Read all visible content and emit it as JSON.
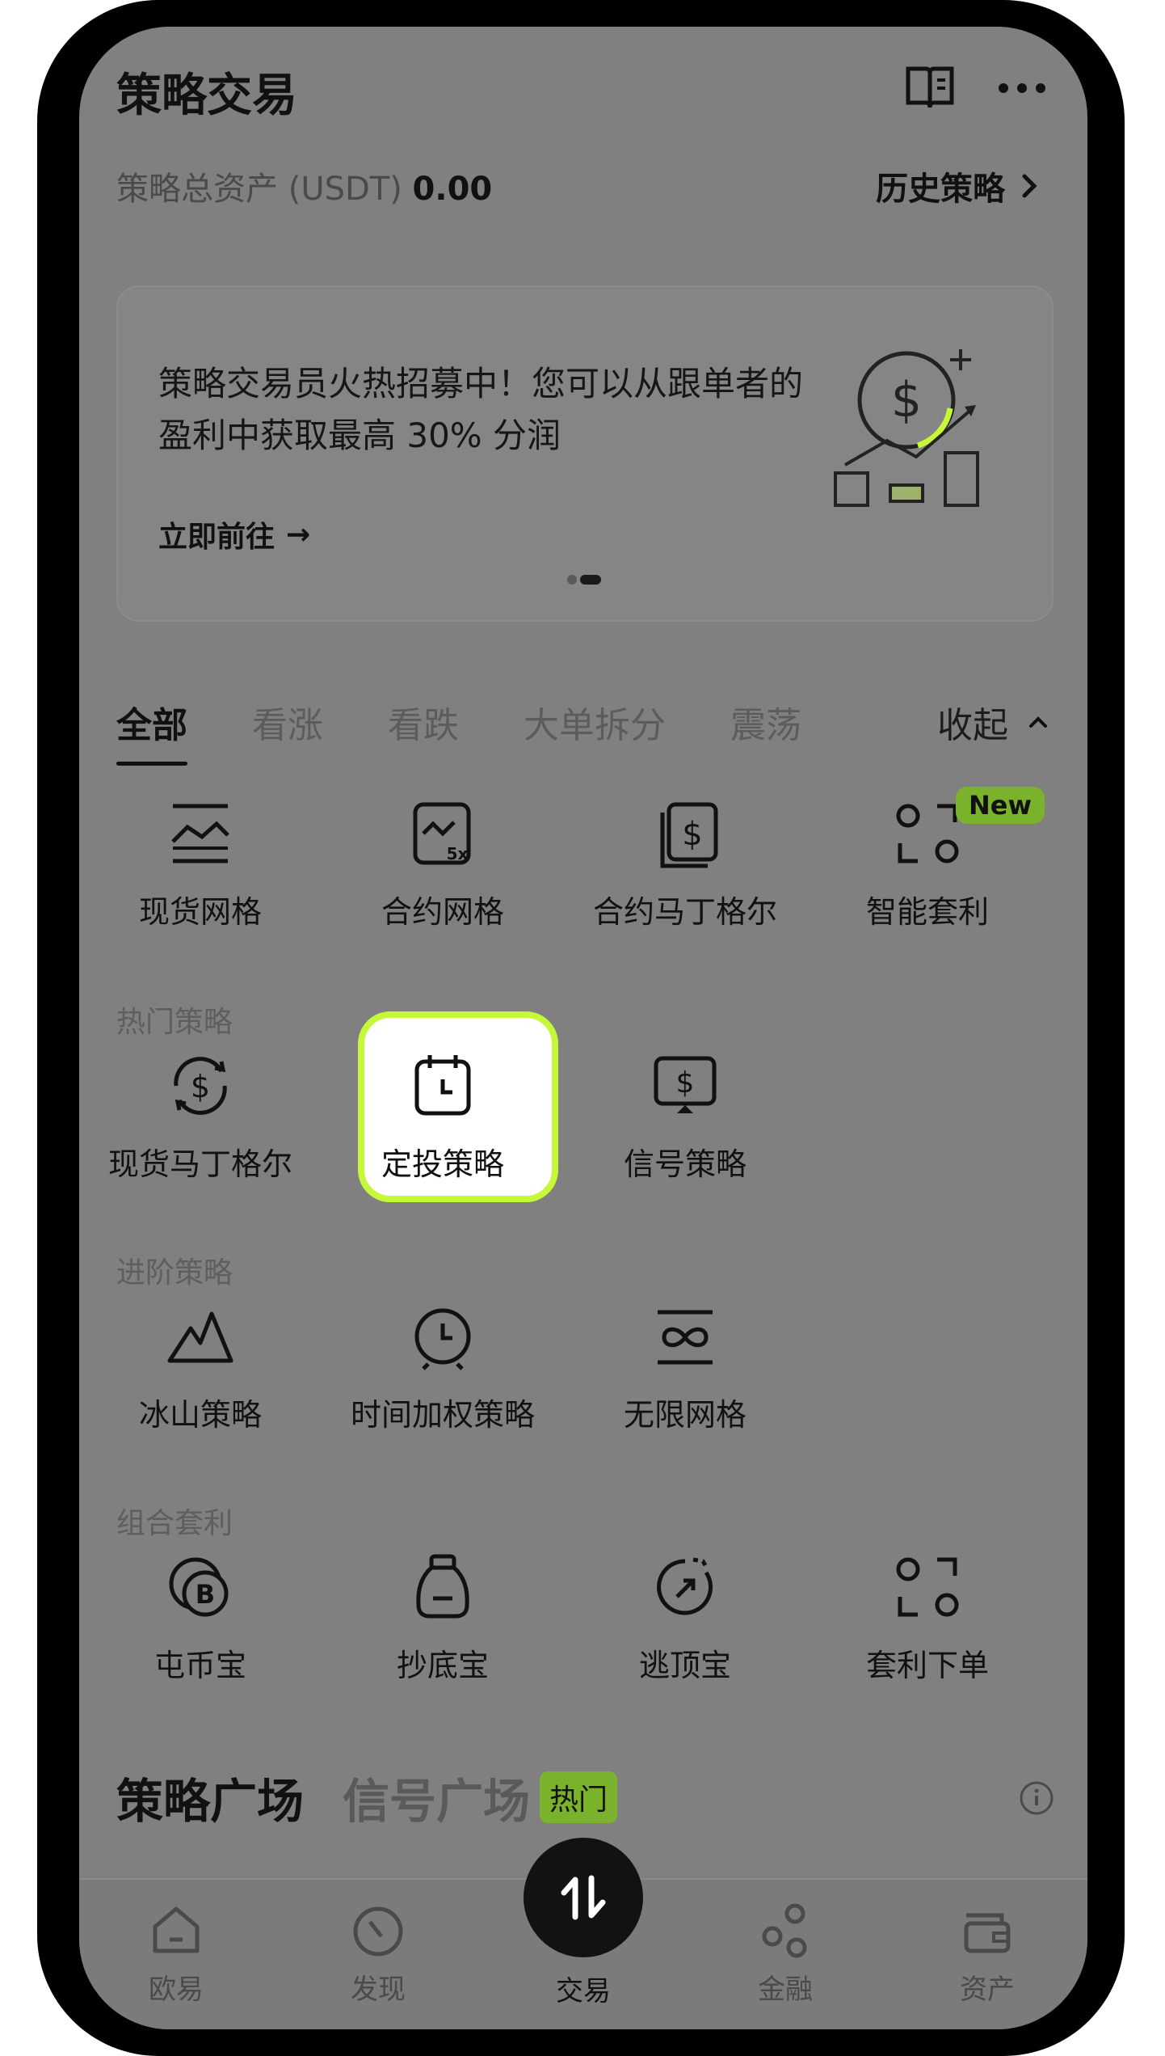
{
  "header": {
    "title": "策略交易"
  },
  "assets": {
    "label": "策略总资产 (USDT)",
    "value": "0.00",
    "history_label": "历史策略"
  },
  "banner": {
    "text": "策略交易员火热招募中！您可以从跟单者的盈利中获取最高 30% 分润",
    "cta": "立即前往",
    "cta_arrow": "→",
    "illustration": "dollar-chart-illustration"
  },
  "tabs": {
    "items": [
      "全部",
      "看涨",
      "看跌",
      "大单拆分",
      "震荡"
    ],
    "active": "全部",
    "collapse_label": "收起"
  },
  "row_top": {
    "items": [
      {
        "label": "现货网格",
        "icon": "spot-grid-icon"
      },
      {
        "label": "合约网格",
        "icon": "futures-grid-icon"
      },
      {
        "label": "合约马丁格尔",
        "icon": "futures-martingale-icon"
      },
      {
        "label": "智能套利",
        "icon": "smart-arbitrage-icon",
        "badge": "New"
      }
    ]
  },
  "hot": {
    "label": "热门策略",
    "items": [
      {
        "label": "现货马丁格尔",
        "icon": "spot-martingale-icon"
      },
      {
        "label": "定投策略",
        "icon": "recurring-buy-icon",
        "highlighted": true
      },
      {
        "label": "信号策略",
        "icon": "signal-strategy-icon"
      }
    ]
  },
  "advanced": {
    "label": "进阶策略",
    "items": [
      {
        "label": "冰山策略",
        "icon": "iceberg-icon"
      },
      {
        "label": "时间加权策略",
        "icon": "twap-clock-icon"
      },
      {
        "label": "无限网格",
        "icon": "infinity-grid-icon"
      }
    ]
  },
  "combo": {
    "label": "组合套利",
    "items": [
      {
        "label": "屯币宝",
        "icon": "coin-hoard-icon"
      },
      {
        "label": "抄底宝",
        "icon": "buy-the-dip-icon"
      },
      {
        "label": "逃顶宝",
        "icon": "sell-the-top-icon"
      },
      {
        "label": "套利下单",
        "icon": "arbitrage-order-icon"
      }
    ]
  },
  "plaza": {
    "strategy_tab": "策略广场",
    "signal_tab": "信号广场",
    "hot_badge": "热门"
  },
  "tabbar": {
    "items": [
      {
        "label": "欧易",
        "icon": "home-icon"
      },
      {
        "label": "发现",
        "icon": "discover-icon"
      },
      {
        "label": "交易",
        "icon": "trade-swap-icon",
        "active": true
      },
      {
        "label": "金融",
        "icon": "finance-icon"
      },
      {
        "label": "资产",
        "icon": "wallet-icon"
      }
    ]
  },
  "colors": {
    "accent_green": "#c6f83a",
    "badge_green": "#7bb22b",
    "overlay": "#808080"
  }
}
